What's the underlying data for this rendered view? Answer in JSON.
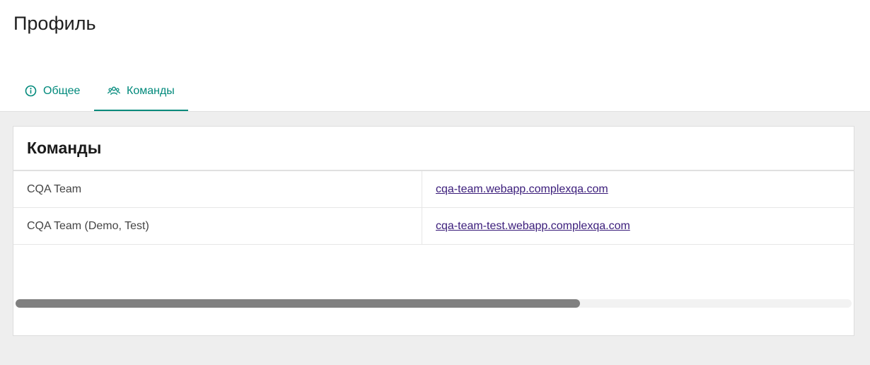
{
  "page": {
    "title": "Профиль"
  },
  "tabs": [
    {
      "label": "Общее",
      "icon": "info-circle-icon",
      "active": false
    },
    {
      "label": "Команды",
      "icon": "users-icon",
      "active": true
    }
  ],
  "teams_card": {
    "title": "Команды",
    "rows": [
      {
        "name": "CQA Team",
        "url": "cqa-team.webapp.complexqa.com"
      },
      {
        "name": "CQA Team (Demo, Test)",
        "url": "cqa-team-test.webapp.complexqa.com"
      }
    ],
    "horizontal_scroll_fraction": 0.675
  },
  "colors": {
    "accent": "#00897b",
    "link": "#3a1c7a",
    "background": "#eeeeee",
    "scroll_thumb": "#808080"
  }
}
